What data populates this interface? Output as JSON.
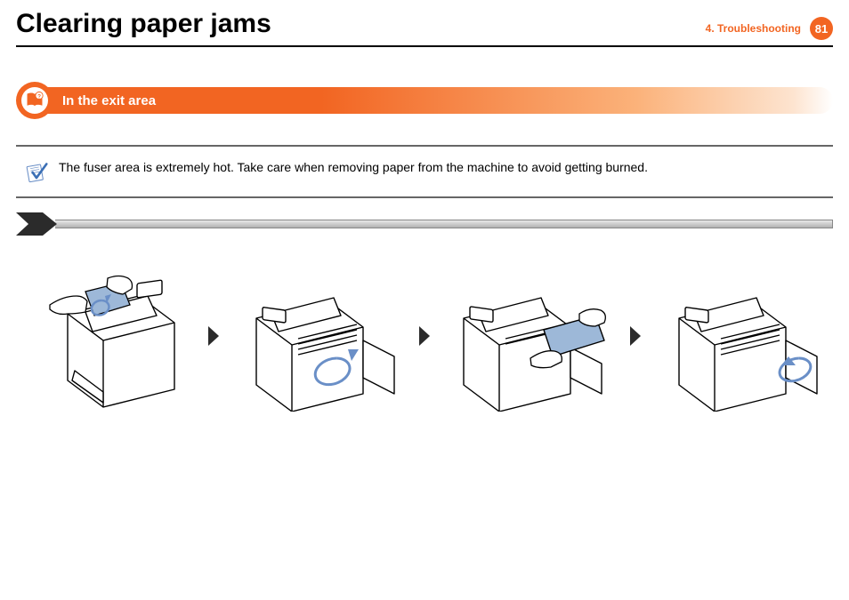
{
  "header": {
    "page_title": "Clearing paper jams",
    "chapter_label": "4.  Troubleshooting",
    "page_number": "81"
  },
  "section": {
    "title": "In the exit area",
    "icon_name": "book-question-icon"
  },
  "note": {
    "icon_name": "note-checkmark-icon",
    "text": "The fuser area is extremely hot. Take care when removing paper from the machine to avoid getting burned."
  },
  "step_bar": {
    "badge_name": "step-arrow-badge"
  },
  "diagrams": {
    "step_1_alt": "Remove jammed paper from output tray on top of printer",
    "step_2_alt": "Open rear cover of printer",
    "step_3_alt": "Pull jammed paper out from rear opening",
    "step_4_alt": "Close rear cover"
  }
}
